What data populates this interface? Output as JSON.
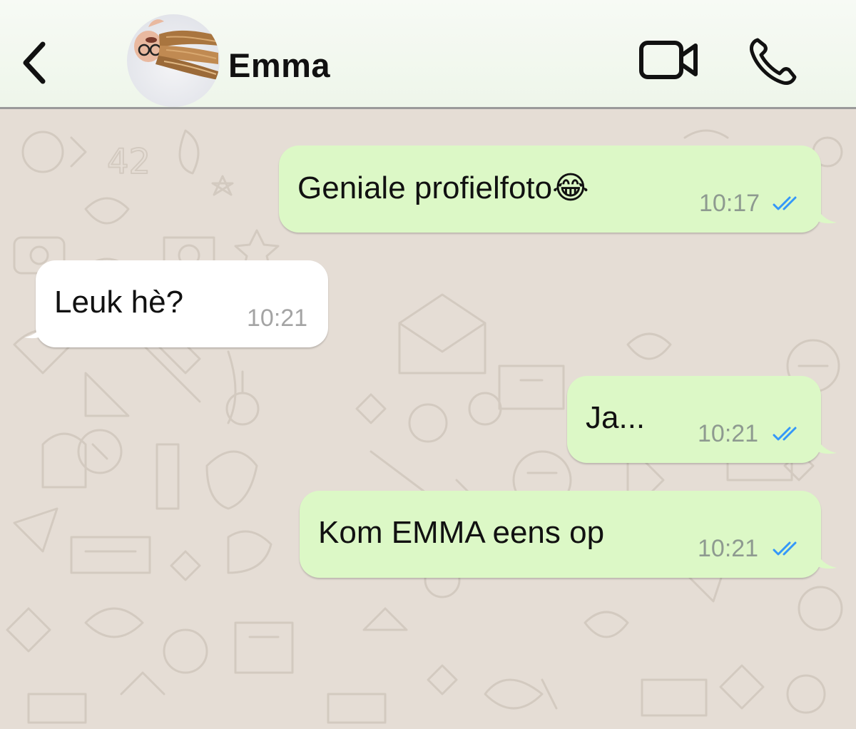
{
  "header": {
    "back_icon": "chevron-left-icon",
    "contact_name": "Emma",
    "video_icon": "video-camera-icon",
    "call_icon": "phone-icon"
  },
  "colors": {
    "outgoing_bubble": "#dcf8c6",
    "incoming_bubble": "#ffffff",
    "wallpaper": "#e5ddd5",
    "read_ticks": "#3497f9"
  },
  "messages": [
    {
      "direction": "outgoing",
      "text": "Geniale profielfoto",
      "emoji": "😂",
      "time": "10:17",
      "status": "read"
    },
    {
      "direction": "incoming",
      "text": "Leuk hè?",
      "time": "10:21"
    },
    {
      "direction": "outgoing",
      "text": "Ja...",
      "time": "10:21",
      "status": "read"
    },
    {
      "direction": "outgoing",
      "text": "Kom EMMA eens op",
      "time": "10:21",
      "status": "read"
    }
  ]
}
